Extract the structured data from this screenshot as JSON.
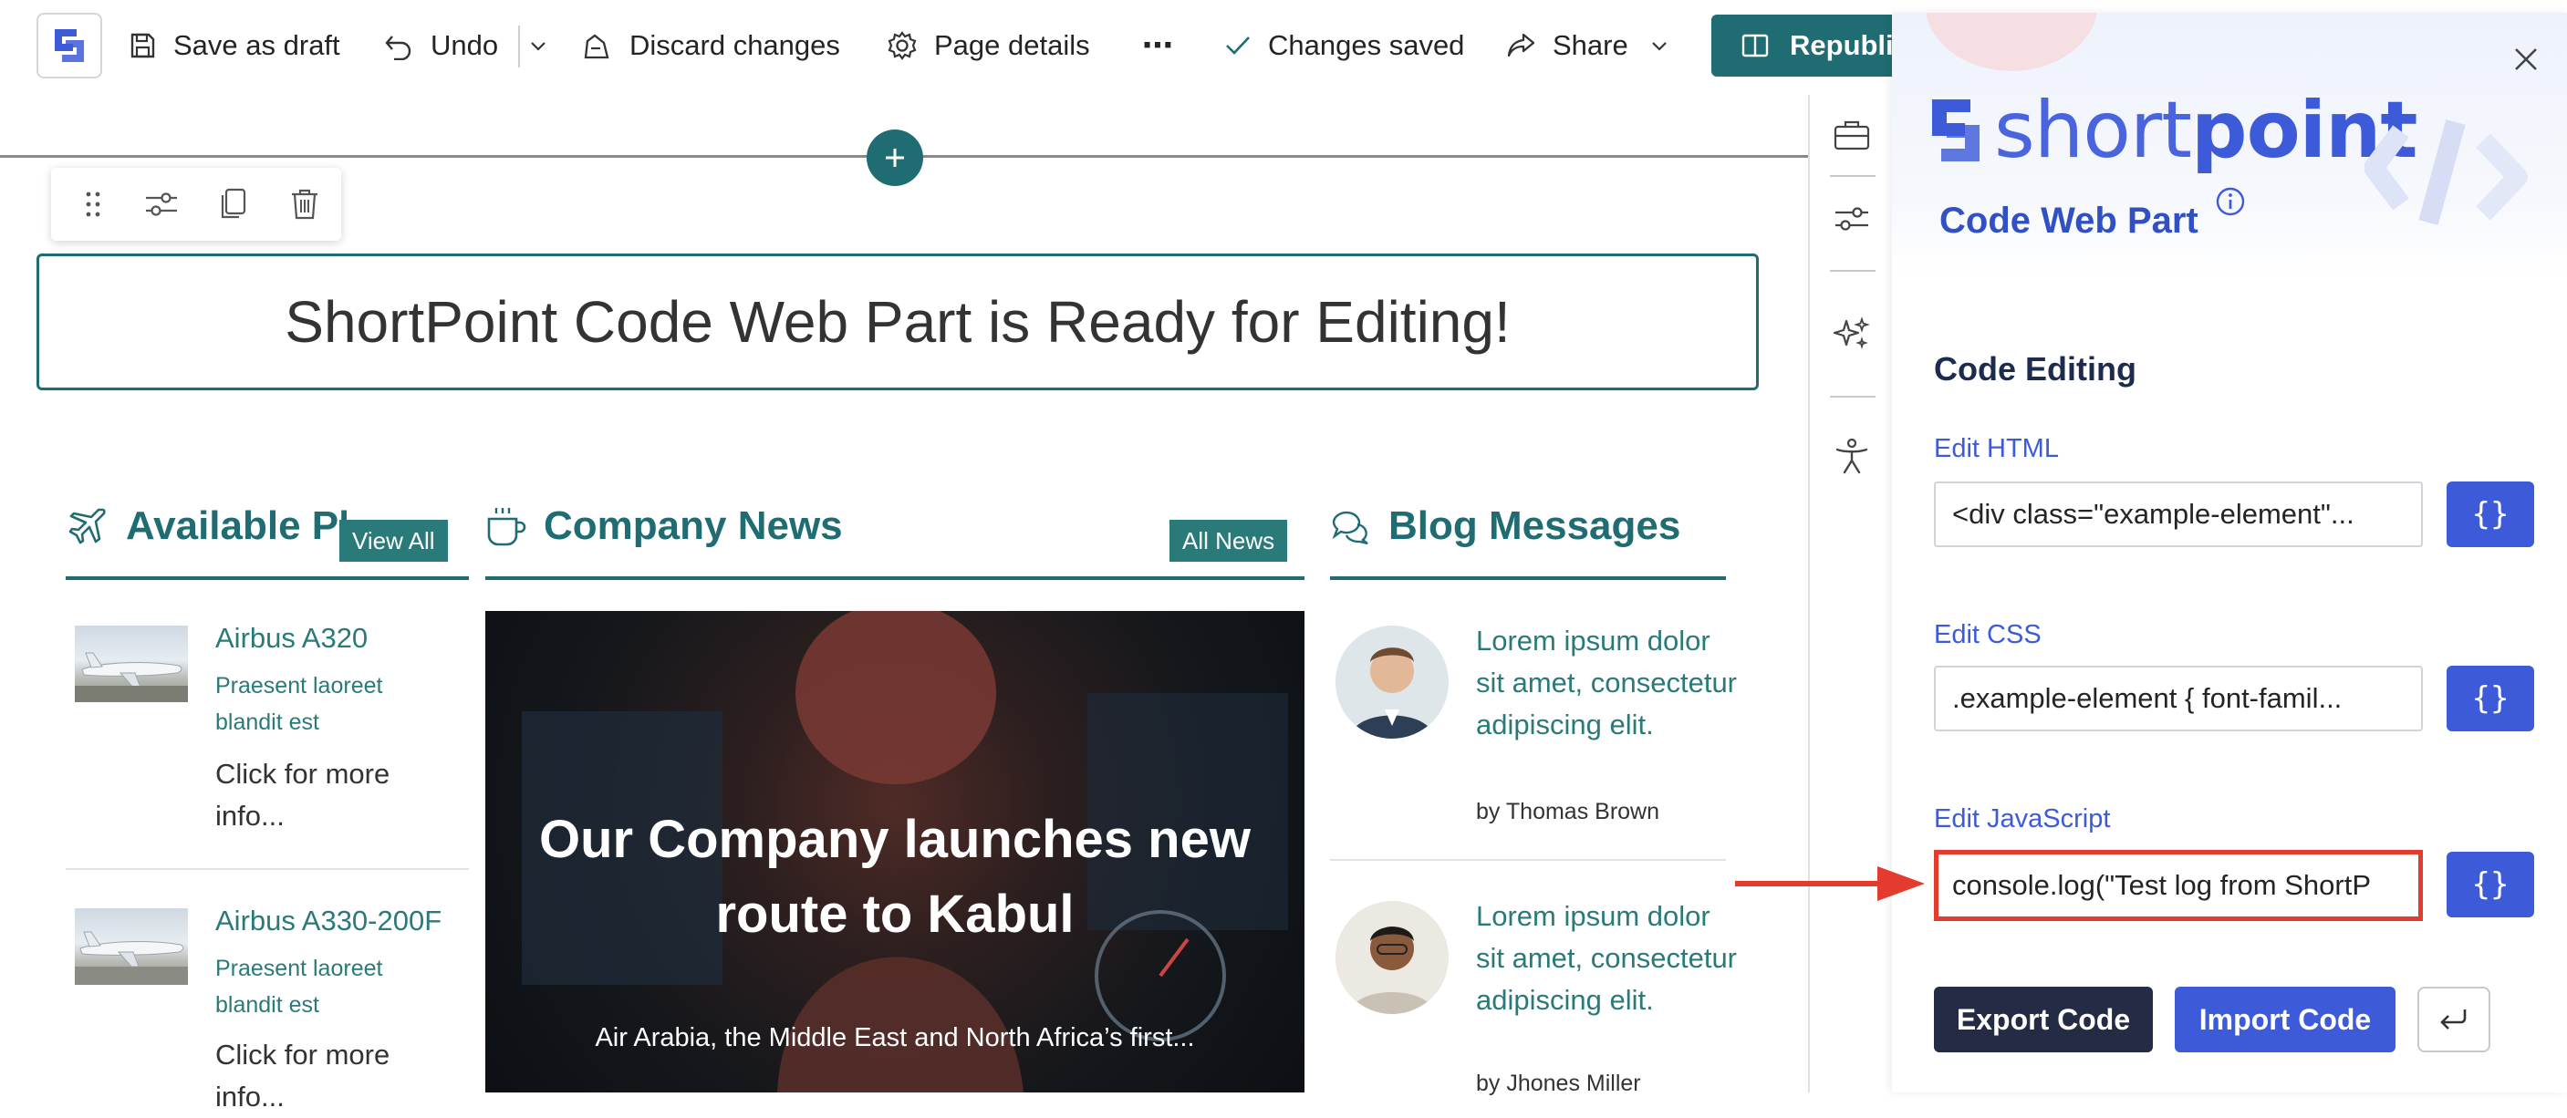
{
  "toolbar": {
    "save_draft": "Save as draft",
    "undo": "Undo",
    "discard": "Discard changes",
    "page_details": "Page details",
    "more": "⋯",
    "changes_saved": "Changes saved",
    "share": "Share",
    "republish": "Republish"
  },
  "banner": {
    "text": "ShortPoint Code Web Part is Ready for Editing!"
  },
  "columns": {
    "planes": {
      "title": "Available Planes",
      "button": "View All",
      "items": [
        {
          "title": "Airbus A320",
          "subtitle": "Praesent laoreet blandit est",
          "more": "Click for more info..."
        },
        {
          "title": "Airbus A330-200F",
          "subtitle": "Praesent laoreet blandit est",
          "more": "Click for more info..."
        }
      ]
    },
    "news": {
      "title": "Company News",
      "button": "All News",
      "headline": "Our Company launches new route to Kabul",
      "summary": "Air Arabia, the Middle East and North Africa’s first..."
    },
    "blog": {
      "title": "Blog Messages",
      "items": [
        {
          "text": "Lorem ipsum dolor sit amet, consectetur adipiscing elit.",
          "author": "by Thomas Brown"
        },
        {
          "text": "Lorem ipsum dolor sit amet, consectetur adipiscing elit.",
          "author": "by Jhones Miller"
        }
      ]
    }
  },
  "panel": {
    "brand_bold": "short",
    "brand_light": "point",
    "title": "Code Web Part",
    "section": "Code Editing",
    "html_label": "Edit HTML",
    "html_value": "<div class=\"example-element\"...",
    "css_label": "Edit CSS",
    "css_value": ".example-element {    font-famil...",
    "js_label": "Edit JavaScript",
    "js_value": "console.log(\"Test log from ShortP",
    "brace": "{}",
    "export": "Export Code",
    "import": "Import Code"
  },
  "colors": {
    "teal": "#1f6c72",
    "brand_blue": "#3d5bd9",
    "dark_navy": "#242c45",
    "highlight_red": "#e33b2d"
  }
}
